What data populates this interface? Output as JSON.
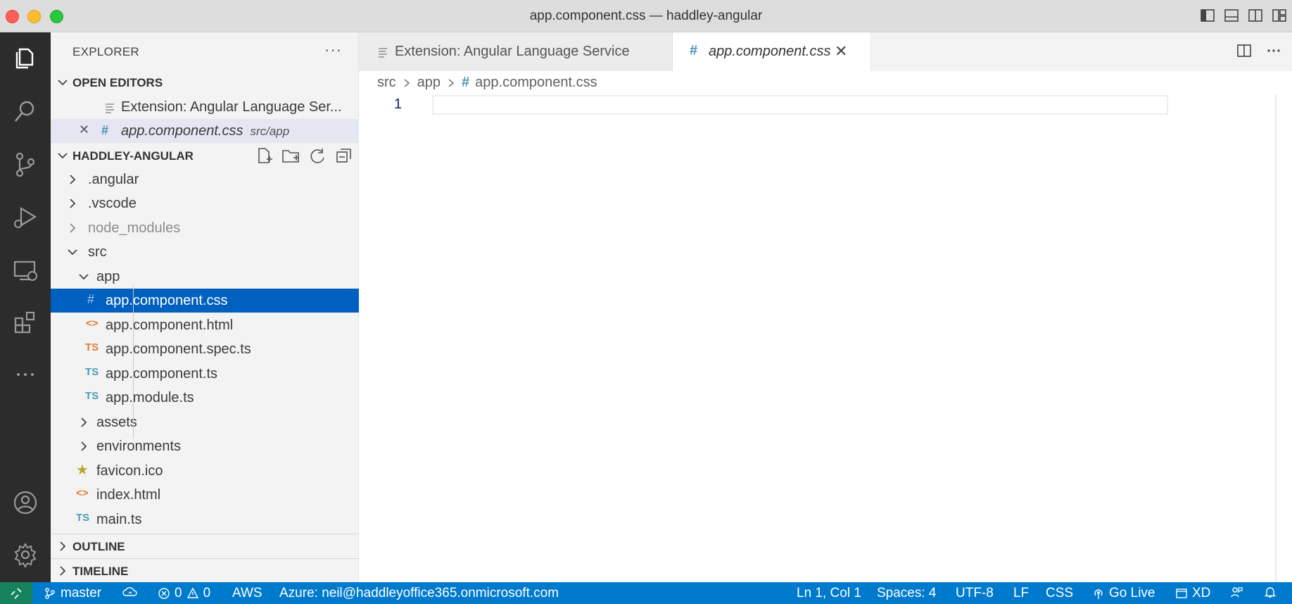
{
  "window": {
    "title": "app.component.css — haddley-angular"
  },
  "sidebar": {
    "title": "EXPLORER",
    "more": "···",
    "open_editors": {
      "label": "OPEN EDITORS",
      "items": [
        {
          "label": "Extension: Angular Language Ser..."
        },
        {
          "label": "app.component.css",
          "desc": "src/app"
        }
      ]
    },
    "project": {
      "label": "HADDLEY-ANGULAR",
      "tree": [
        {
          "label": ".angular"
        },
        {
          "label": ".vscode"
        },
        {
          "label": "node_modules"
        },
        {
          "label": "src"
        },
        {
          "label": "app"
        },
        {
          "label": "app.component.css",
          "icon": "#"
        },
        {
          "label": "app.component.html",
          "icon": "<>"
        },
        {
          "label": "app.component.spec.ts",
          "icon": "TS"
        },
        {
          "label": "app.component.ts",
          "icon": "TS"
        },
        {
          "label": "app.module.ts",
          "icon": "TS"
        },
        {
          "label": "assets"
        },
        {
          "label": "environments"
        },
        {
          "label": "favicon.ico",
          "icon": "★"
        },
        {
          "label": "index.html",
          "icon": "<>"
        },
        {
          "label": "main.ts",
          "icon": "TS"
        }
      ]
    },
    "outline": "OUTLINE",
    "timeline": "TIMELINE"
  },
  "editor": {
    "tabs": [
      {
        "label": "Extension: Angular Language Service"
      },
      {
        "label": "app.component.css",
        "icon": "#"
      }
    ],
    "breadcrumb": [
      "src",
      "app",
      "app.component.css"
    ],
    "breadcrumb_icon": "#",
    "line_number": "1"
  },
  "status": {
    "branch": "master",
    "errors": "0",
    "warnings": "0",
    "aws": "AWS",
    "azure": "Azure: neil@haddleyoffice365.onmicrosoft.com",
    "position": "Ln 1, Col 1",
    "spaces": "Spaces: 4",
    "encoding": "UTF-8",
    "eol": "LF",
    "language": "CSS",
    "golive": "Go Live",
    "xd": "XD"
  },
  "colors": {
    "accent": "#007acc",
    "selection": "#0060c0",
    "activity_bar": "#2c2c2c",
    "remote": "#16825d"
  }
}
